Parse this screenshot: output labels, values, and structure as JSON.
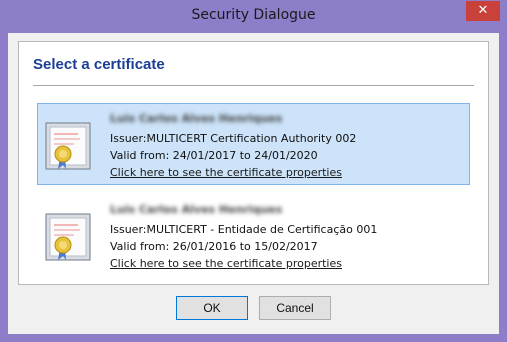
{
  "window": {
    "title": "Security Dialogue",
    "close_label": "✕"
  },
  "dialog": {
    "heading": "Select a certificate",
    "certificates": [
      {
        "name": "Luis Carlos Alves Henriques",
        "issuer": "Issuer:MULTICERT Certification Authority 002",
        "valid": "Valid from: 24/01/2017 to 24/01/2020",
        "link": "Click here to see the certificate properties",
        "selected": true,
        "icon": "certificate-icon"
      },
      {
        "name": "Luis Carlos Alves Henriques",
        "issuer": "Issuer:MULTICERT - Entidade de Certificação 001",
        "valid": "Valid from: 26/01/2016 to 15/02/2017",
        "link": "Click here to see the certificate properties",
        "selected": false,
        "icon": "certificate-icon"
      }
    ]
  },
  "buttons": {
    "ok_label": "OK",
    "cancel_label": "Cancel"
  },
  "colors": {
    "title_bar": "#8e7dc9",
    "heading": "#1c3f94",
    "selection_bg": "#cce3f9",
    "selection_border": "#7eb4ea",
    "close_button": "#c8413a"
  }
}
